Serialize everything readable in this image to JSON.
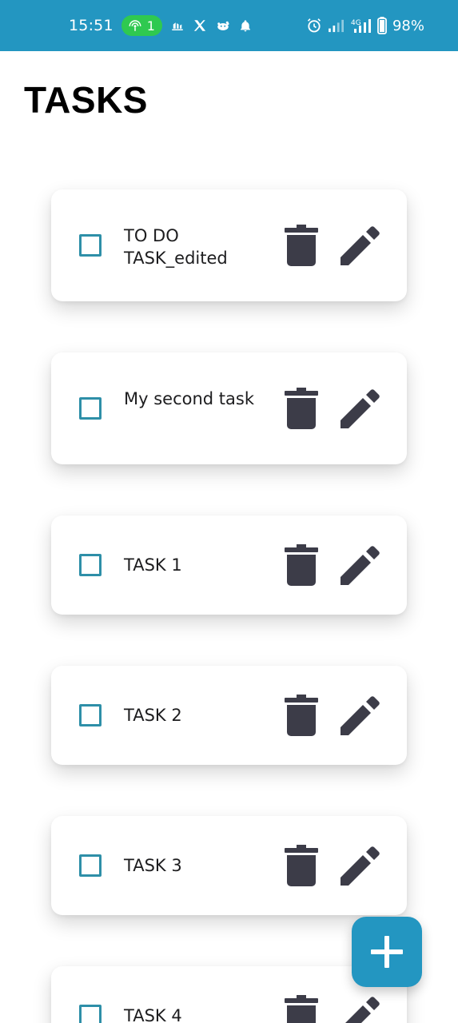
{
  "status_bar": {
    "time": "15:51",
    "hotspot_count": "1",
    "battery_text": "98%",
    "network_label": "4G",
    "left_icons": [
      "hotspot-icon",
      "lean-icon",
      "x-icon",
      "reddit-icon",
      "bell-icon"
    ],
    "right_icons": [
      "alarm-icon",
      "signal-icon",
      "signal-4g-icon",
      "battery-icon"
    ]
  },
  "header": {
    "title": "TASKS"
  },
  "tasks": [
    {
      "label": "TO DO TASK_edited",
      "checked": false
    },
    {
      "label": "My second task",
      "checked": false
    },
    {
      "label": "TASK 1",
      "checked": false
    },
    {
      "label": "TASK 2",
      "checked": false
    },
    {
      "label": "TASK 3",
      "checked": false
    },
    {
      "label": "TASK 4",
      "checked": false
    }
  ],
  "colors": {
    "accent": "#2396c1",
    "checkbox": "#2e8fa8",
    "icon": "#3c3c48",
    "hotspot_pill": "#2fc950"
  },
  "fab": {
    "icon": "plus-icon"
  }
}
